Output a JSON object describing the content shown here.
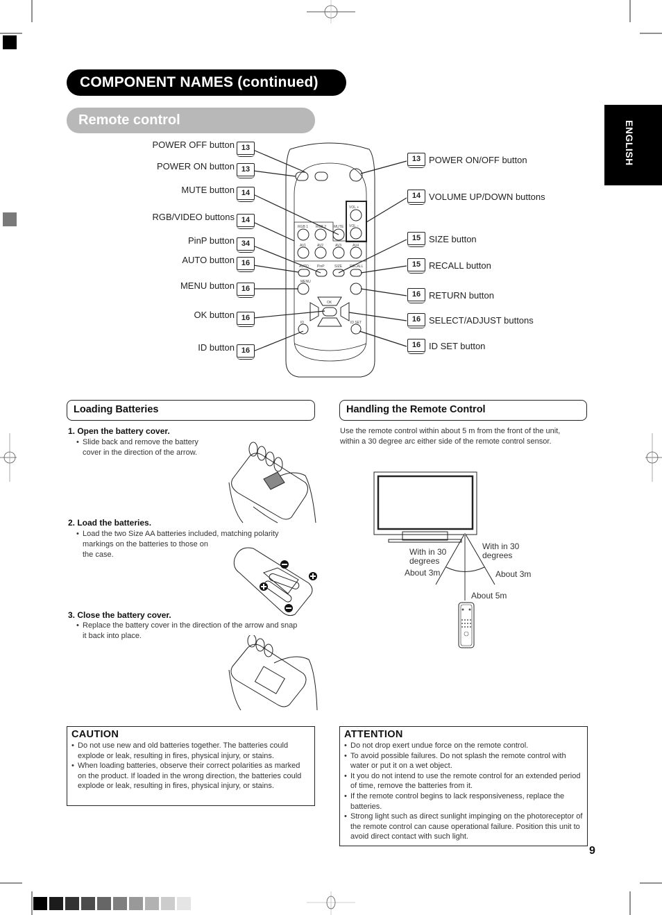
{
  "page": {
    "title": "COMPONENT NAMES (continued)",
    "subtitle": "Remote control",
    "language_tab": "ENGLISH",
    "page_number": "9"
  },
  "remote_diagram": {
    "left_callouts": [
      {
        "label": "POWER OFF button",
        "ref": "13"
      },
      {
        "label": "POWER ON button",
        "ref": "13"
      },
      {
        "label": "MUTE button",
        "ref": "14"
      },
      {
        "label": "RGB/VIDEO buttons",
        "ref": "14"
      },
      {
        "label": "PinP button",
        "ref": "34"
      },
      {
        "label": "AUTO button",
        "ref": "16"
      },
      {
        "label": "MENU button",
        "ref": "16"
      },
      {
        "label": "OK button",
        "ref": "16"
      },
      {
        "label": "ID button",
        "ref": "16"
      }
    ],
    "right_callouts": [
      {
        "label": "POWER ON/OFF button",
        "ref": "13"
      },
      {
        "label": "VOLUME UP/DOWN buttons",
        "ref": "14"
      },
      {
        "label": "SIZE button",
        "ref": "15"
      },
      {
        "label": "RECALL button",
        "ref": "15"
      },
      {
        "label": "RETURN button",
        "ref": "16"
      },
      {
        "label": "SELECT/ADJUST buttons",
        "ref": "16"
      },
      {
        "label": "ID SET button",
        "ref": "16"
      }
    ],
    "remote_keys": {
      "vol_plus": "VOL +",
      "vol_minus": "VOL −",
      "rgb1": "RGB 1",
      "rgb2": "RGB 2",
      "mute": "MUTE",
      "av1": "AV1",
      "av2": "AV2",
      "av3": "AV3",
      "av4": "AV4",
      "auto": "AUTO",
      "pinp": "PinP",
      "size": "SIZE",
      "recall": "RECALL",
      "menu": "MENU",
      "ok": "OK",
      "id": "ID",
      "idset": "ID SET"
    }
  },
  "loading_batteries": {
    "heading": "Loading Batteries",
    "steps": [
      {
        "title": "1. Open the battery cover.",
        "bullets": [
          "Slide back and remove the battery",
          "cover in the direction of the arrow."
        ]
      },
      {
        "title": "2. Load the batteries.",
        "bullets": [
          "Load the two Size AA batteries included, matching polarity",
          "markings on the batteries to those on",
          "the case."
        ]
      },
      {
        "title": "3. Close the battery cover.",
        "bullets": [
          "Replace the battery cover in the direction of the arrow and snap",
          "it back into place."
        ]
      }
    ]
  },
  "handling": {
    "heading": "Handling the Remote Control",
    "text_lines": [
      "Use the remote control within about 5 m from the front of the unit,",
      "within a 30 degree arc either side of the remote control sensor."
    ],
    "diagram": {
      "left_angle": [
        "With in 30",
        "degrees"
      ],
      "right_angle": [
        "With in 30",
        "degrees"
      ],
      "left_distance": "About 3m",
      "right_distance": "About 3m",
      "center_distance": "About 5m"
    }
  },
  "caution": {
    "heading": "CAUTION",
    "items": [
      "Do not use new and old batteries together.  The batteries could explode or leak, resulting in fires, physical injury, or stains.",
      "When loading batteries, observe their correct polarities as marked on the product. If loaded in the wrong direction, the batteries could explode or leak, resulting in fires, physical injury, or stains."
    ]
  },
  "attention": {
    "heading": "ATTENTION",
    "items": [
      "Do not drop exert undue force on the remote control.",
      "To avoid possible failures. Do not splash the remote control with water or put it on a wet object.",
      "It you do not intend to use the remote control for an extended period of time, remove the batteries from it.",
      "If the remote control begins to lack responsiveness, replace the batteries.",
      "Strong light such as direct sunlight impinging on the photoreceptor of the remote control can cause operational failure. Position this unit to avoid direct contact with such light."
    ]
  },
  "print_marks": {
    "grayscale_swatches": [
      "#000000",
      "#1c1c1c",
      "#333333",
      "#4c4c4c",
      "#666666",
      "#7f7f7f",
      "#999999",
      "#b2b2b2",
      "#cccccc",
      "#e5e5e5"
    ]
  }
}
